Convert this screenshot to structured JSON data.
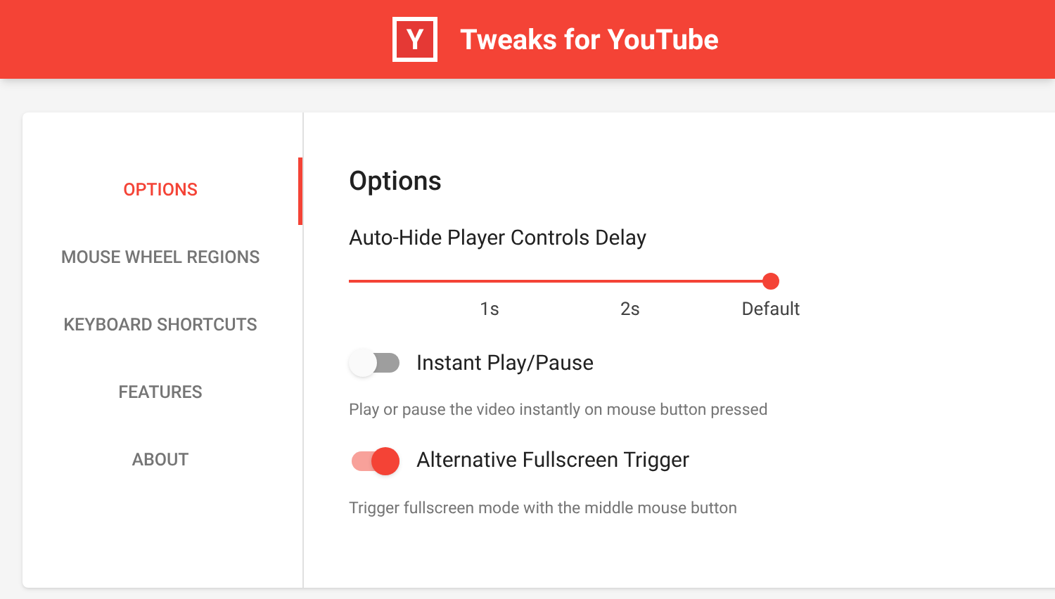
{
  "header": {
    "logo_letter": "Y",
    "title": "Tweaks for YouTube"
  },
  "sidebar": {
    "items": [
      {
        "label": "OPTIONS",
        "selected": true
      },
      {
        "label": "MOUSE WHEEL REGIONS",
        "selected": false
      },
      {
        "label": "KEYBOARD SHORTCUTS",
        "selected": false
      },
      {
        "label": "FEATURES",
        "selected": false
      },
      {
        "label": "ABOUT",
        "selected": false
      }
    ]
  },
  "content": {
    "heading": "Options",
    "slider": {
      "label": "Auto-Hide Player Controls Delay",
      "level": 1,
      "stops": [
        "1s",
        "2s",
        "Default"
      ]
    },
    "toggles": [
      {
        "label": "Instant Play/Pause",
        "on": false,
        "description": "Play or pause the video instantly on mouse button pressed"
      },
      {
        "label": "Alternative Fullscreen Trigger",
        "on": true,
        "description": "Trigger fullscreen mode with the middle mouse button"
      }
    ]
  }
}
